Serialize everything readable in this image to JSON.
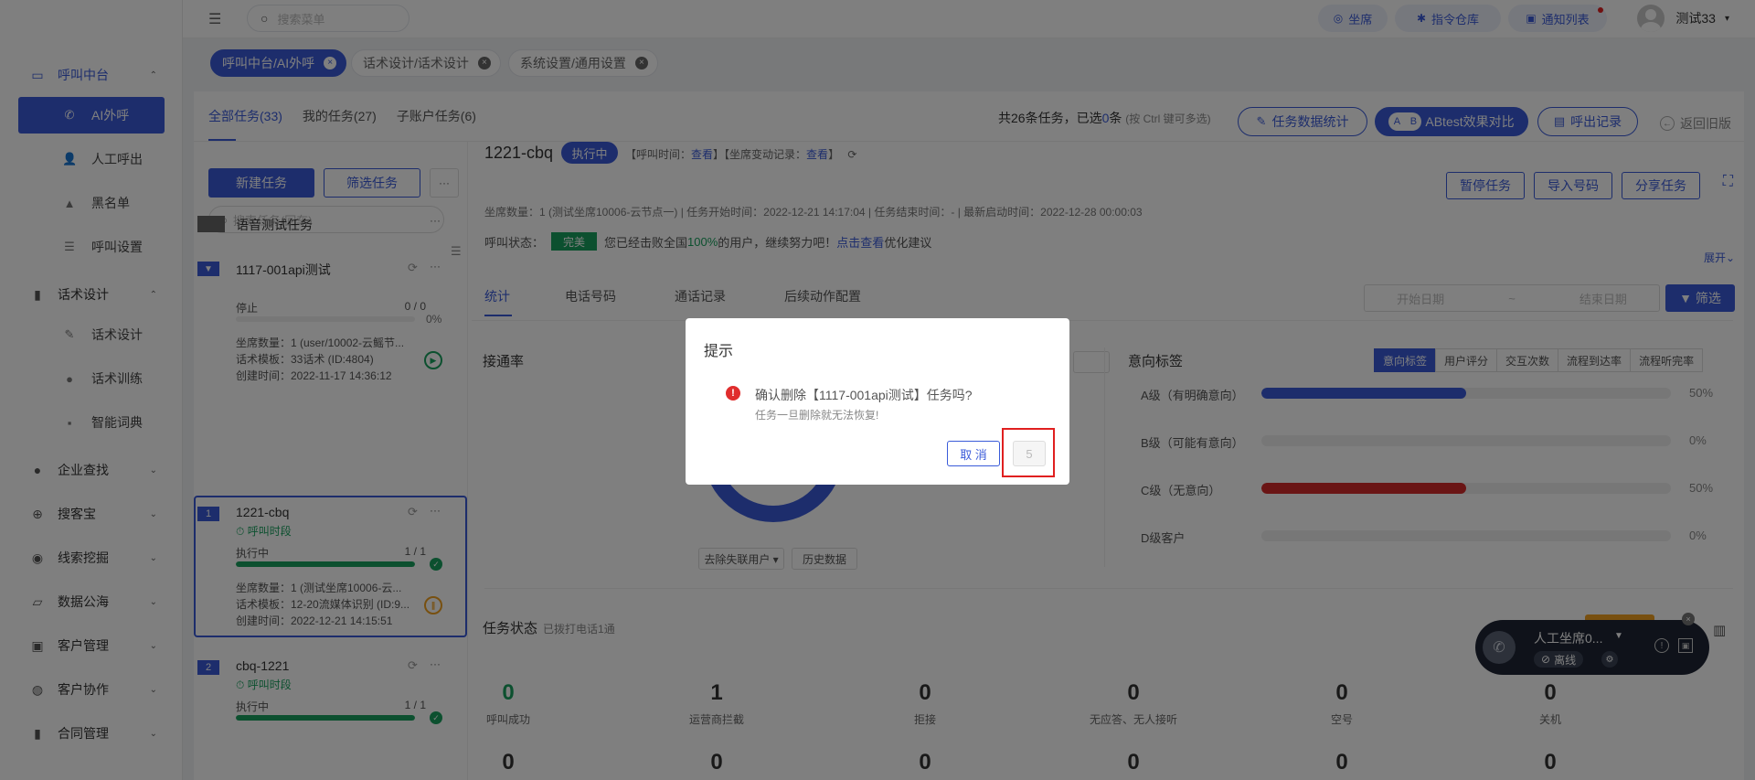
{
  "sidebar": {
    "groups": [
      {
        "label": "呼叫中台",
        "icon": "monitor-icon",
        "chevron": "⌃",
        "active": true,
        "items": [
          {
            "label": "AI外呼",
            "icon": "phone-icon",
            "active": true
          },
          {
            "label": "人工呼出",
            "icon": "person-icon"
          },
          {
            "label": "黑名单",
            "icon": "warning-icon"
          },
          {
            "label": "呼叫设置",
            "icon": "sliders-icon"
          }
        ]
      },
      {
        "label": "话术设计",
        "icon": "book-icon",
        "chevron": "⌃",
        "items": [
          {
            "label": "话术设计",
            "icon": "pen-icon"
          },
          {
            "label": "话术训练",
            "icon": "chat-icon"
          },
          {
            "label": "智能词典",
            "icon": "dictionary-icon"
          }
        ]
      },
      {
        "label": "企业查找",
        "icon": "bulb-icon",
        "chevron": "⌄"
      },
      {
        "label": "搜客宝",
        "icon": "search-icon",
        "chevron": "⌄"
      },
      {
        "label": "线索挖掘",
        "icon": "target-icon",
        "chevron": "⌄"
      },
      {
        "label": "数据公海",
        "icon": "chart-icon",
        "chevron": "⌄"
      },
      {
        "label": "客户管理",
        "icon": "contacts-icon",
        "chevron": "⌄"
      },
      {
        "label": "客户协作",
        "icon": "team-icon",
        "chevron": "⌄"
      },
      {
        "label": "合同管理",
        "icon": "clipboard-icon",
        "chevron": "⌄"
      }
    ]
  },
  "topbar": {
    "search_placeholder": "搜索菜单",
    "buttons": [
      {
        "label": "坐席",
        "icon": "headset-icon"
      },
      {
        "label": "指令仓库",
        "icon": "bug-icon"
      },
      {
        "label": "通知列表",
        "icon": "notice-icon",
        "dot": true
      }
    ],
    "user_name": "测试33",
    "user_caret": "▾"
  },
  "tags": [
    {
      "label": "呼叫中台/AI外呼",
      "active": true
    },
    {
      "label": "话术设计/话术设计",
      "active": false
    },
    {
      "label": "系统设置/通用设置",
      "active": false
    }
  ],
  "task_tabs": [
    "全部任务(33)",
    "我的任务(27)",
    "子账户任务(6)"
  ],
  "summary": {
    "prefix": "共26条任务，已选",
    "selected": "0",
    "suffix": "条",
    "hint": "(按 Ctrl 键可多选)"
  },
  "actions": {
    "task_stats": "任务数据统计",
    "ab_badge_a": "A",
    "ab_badge_b": "B",
    "abtest": "ABtest效果对比",
    "call_records": "呼出记录",
    "back_old": "返回旧版"
  },
  "list_panel": {
    "new_task": "新建任务",
    "filter_task": "筛选任务",
    "more": "···",
    "search_placeholder": "搜索任务(回车)",
    "tasks": [
      {
        "title": "语音测试任务"
      },
      {
        "title": "1117-001api测试",
        "badge": "📌",
        "status": "停止",
        "count": "0 / 0",
        "pct": "0%",
        "progress": 0,
        "seats": "坐席数量：1 (user/10002-云鳐节...",
        "template": "话术模板：33话术 (ID:4804)",
        "created": "创建时间：2022-11-17 14:36:12"
      },
      {
        "title": "1221-cbq",
        "badge": "1",
        "time_tag": "⏱ 呼叫时段",
        "status": "执行中",
        "count": "1 / 1",
        "progress": 1.0,
        "seats": "坐席数量：1 (测试坐席10006-云...",
        "template": "话术模板：12-20流媒体识别 (ID:9...",
        "created": "创建时间：2022-12-21 14:15:51"
      },
      {
        "title": "cbq-1221",
        "badge": "2",
        "time_tag": "⏱ 呼叫时段",
        "status": "执行中",
        "count": "1 / 1",
        "progress": 1.0
      }
    ]
  },
  "detail": {
    "title": "1221-cbq",
    "running": "执行中",
    "links_1": "【呼叫时间：",
    "link_view": "查看",
    "links_2": "】【坐席变动记录：",
    "links_3": "】",
    "meta": "坐席数量：1 (测试坐席10006-云节点一)   |   任务开始时间：2022-12-21 14:17:04   |   任务结束时间：-   |   最新启动时间：2022-12-28 00:00:03",
    "status_label": "呼叫状态：",
    "done_badge": "完美",
    "status_text_1": "您已经击败全国",
    "status_pct": "100%",
    "status_text_2": "的用户，继续努力吧！",
    "status_link": "点击查看",
    "status_text_3": "优化建议",
    "buttons": [
      "暂停任务",
      "导入号码",
      "分享任务"
    ],
    "expand": "展开⌄",
    "sub_tabs": [
      "统计",
      "电话号码",
      "通话记录",
      "后续动作配置"
    ],
    "date_start": "开始日期",
    "date_sep": "~",
    "date_end": "结束日期",
    "filter": "筛选",
    "connect_rate": "接通率",
    "donut_btn_1": "去除失联用户 ▾",
    "donut_btn_2": "历史数据",
    "intent_title": "意向标签",
    "intent_tabs": [
      "意向标签",
      "用户评分",
      "交互次数",
      "流程到达率",
      "流程听完率"
    ],
    "intent_rows": [
      {
        "label": "A级（有明确意向）",
        "value": "50%",
        "fraction": 0.5,
        "color": "#3a5bd9"
      },
      {
        "label": "B级（可能有意向）",
        "value": "0%",
        "fraction": 0,
        "color": "#3a5bd9"
      },
      {
        "label": "C级（无意向）",
        "value": "50%",
        "fraction": 0.5,
        "color": "#d42a2a"
      },
      {
        "label": "D级客户",
        "value": "0%",
        "fraction": 0,
        "color": "#3a5bd9"
      }
    ],
    "task_status_title": "任务状态",
    "task_status_sub": "已拨打电话1通",
    "stats": [
      {
        "n": "0",
        "label": "呼叫成功",
        "green": true
      },
      {
        "n": "1",
        "label": "运营商拦截"
      },
      {
        "n": "0",
        "label": "拒接"
      },
      {
        "n": "0",
        "label": "无应答、无人接听"
      },
      {
        "n": "0",
        "label": "空号"
      },
      {
        "n": "0",
        "label": "关机"
      }
    ],
    "stats_row2": [
      "0",
      "0",
      "0",
      "0",
      "0",
      "0"
    ]
  },
  "phone_widget": {
    "name": "人工坐席0...",
    "status": "离线",
    "close": "×"
  },
  "dialog": {
    "title": "提示",
    "message": "确认删除【1117-001api测试】任务吗?",
    "sub": "任务一旦删除就无法恢复!",
    "cancel": "取 消",
    "confirm": "5"
  },
  "donut_data": {
    "connected_fraction": 1.0,
    "color": "#3a5bd9"
  }
}
